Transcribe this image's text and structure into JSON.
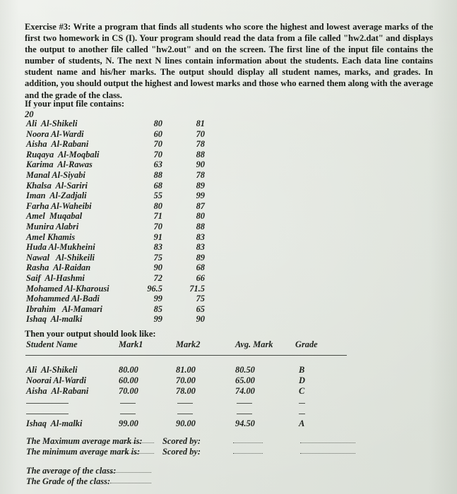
{
  "document": {
    "exercise_label": "Exercise #3:",
    "intro_text": " Write a program that finds all students who score the highest and lowest average marks of the first two homework in CS (I).  Your program should read the data from a file called \"hw2.dat\" and displays the output to another file called \"hw2.out\" and on the screen. The first line of the input file contains the number of students, N. The next N lines contain information about the students. Each data line contains student name and his/her marks. The output should display all student names, marks, and grades. In addition, you should output the highest and lowest marks and those who earned them along with the average and the grade of the class.",
    "input_file_name": "hw2.dat",
    "output_file_name": "hw2.out",
    "if_input_line": "If your input file contains:",
    "student_count": "20",
    "then_output_line": "Then your output should look like:"
  },
  "input_data": {
    "rows": [
      {
        "name": "Ali  Al-Shikeli",
        "mark1": "80",
        "mark2": "81"
      },
      {
        "name": "Noora Al-Wardi",
        "mark1": "60",
        "mark2": "70"
      },
      {
        "name": "Aisha  Al-Rabani",
        "mark1": "70",
        "mark2": "78"
      },
      {
        "name": "Ruqaya  Al-Moqbali",
        "mark1": "70",
        "mark2": "88"
      },
      {
        "name": "Karima  Al-Rawas",
        "mark1": "63",
        "mark2": "90"
      },
      {
        "name": "Manal Al-Siyabi",
        "mark1": "88",
        "mark2": "78"
      },
      {
        "name": "Khalsa  Al-Sariri",
        "mark1": "68",
        "mark2": "89"
      },
      {
        "name": "Iman  Al-Zadjali",
        "mark1": "55",
        "mark2": "99"
      },
      {
        "name": "Farha Al-Waheibi",
        "mark1": "80",
        "mark2": "87"
      },
      {
        "name": "Amel  Muqabal",
        "mark1": "71",
        "mark2": "80"
      },
      {
        "name": "Munira Alabri",
        "mark1": "70",
        "mark2": "88"
      },
      {
        "name": "Amel Khamis",
        "mark1": "91",
        "mark2": "83"
      },
      {
        "name": "Huda Al-Mukheini",
        "mark1": "83",
        "mark2": "83"
      },
      {
        "name": "Nawal   Al-Shikeili",
        "mark1": "75",
        "mark2": "89"
      },
      {
        "name": "Rasha  Al-Raidan",
        "mark1": "90",
        "mark2": "68"
      },
      {
        "name": "Saif  Al-Hashmi",
        "mark1": "72",
        "mark2": "66"
      },
      {
        "name": "Mohamed Al-Kharousi",
        "mark1": "96.5",
        "mark2": "71.5"
      },
      {
        "name": "Mohammed Al-Badi",
        "mark1": "99",
        "mark2": "75"
      },
      {
        "name": "Ibrahim   Al-Mamari",
        "mark1": "85",
        "mark2": "65"
      },
      {
        "name": "Ishaq  Al-malki",
        "mark1": "99",
        "mark2": "90"
      }
    ]
  },
  "output_table": {
    "headers": {
      "name": "Student Name",
      "mark1": "Mark1",
      "mark2": "Mark2",
      "avg": "Avg. Mark",
      "grade": "Grade"
    },
    "rows": [
      {
        "name": "Ali  Al-Shikeli",
        "mark1": "80.00",
        "mark2": "81.00",
        "avg": "80.50",
        "grade": "B"
      },
      {
        "name": "Noorai Al-Wardi",
        "mark1": "60.00",
        "mark2": "70.00",
        "avg": "65.00",
        "grade": "D"
      },
      {
        "name": "Aisha  Al-Rabani",
        "mark1": "70.00",
        "mark2": "78.00",
        "avg": "74.00",
        "grade": "C"
      }
    ],
    "last_row": {
      "name": "Ishaq  Al-malki",
      "mark1": "99.00",
      "mark2": "90.00",
      "avg": "94.50",
      "grade": "A"
    }
  },
  "summary": {
    "max_label": "The Maximum average mark is:",
    "max_scored_by": "Scored by:",
    "min_label": "The minimum average mark is:",
    "min_scored_by": "Scored by:",
    "class_average_label": "The average of the class:",
    "class_grade_label": "The Grade of the class:"
  },
  "colors": {
    "paper": "#e4e8e1",
    "ink": "#1d211c"
  }
}
